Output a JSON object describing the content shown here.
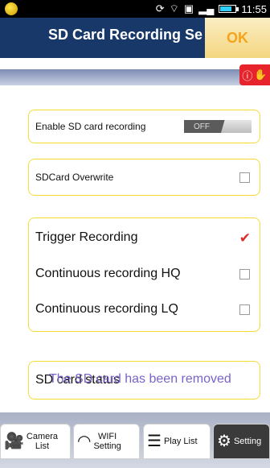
{
  "status_bar": {
    "time": "11:55"
  },
  "header": {
    "title": "SD Card Recording Se",
    "ok_label": "OK"
  },
  "help": {
    "label": "ⓘ"
  },
  "settings": {
    "enable_label": "Enable SD card recording",
    "enable_state": "OFF",
    "overwrite_label": "SDCard Overwrite",
    "overwrite_checked": false,
    "trigger_label": "Trigger Recording",
    "trigger_checked": true,
    "cont_hq_label": "Continuous recording HQ",
    "cont_hq_checked": false,
    "cont_lq_label": "Continuous recording LQ",
    "cont_lq_checked": false
  },
  "status": {
    "label": "SD card status",
    "value": "The SD card has been removed"
  },
  "tabs": [
    {
      "label": "Camera\nList",
      "icon": "camera-icon"
    },
    {
      "label": "WIFI\nSetting",
      "icon": "wifi-icon"
    },
    {
      "label": "Play List",
      "icon": "list-icon"
    },
    {
      "label": "Setting",
      "icon": "gear-icon"
    }
  ],
  "colors": {
    "header": "#173868",
    "accent_border": "#f4dd33",
    "ok_text": "#f4a51b",
    "status_text": "#7a63c8",
    "check": "#e02a2a"
  }
}
